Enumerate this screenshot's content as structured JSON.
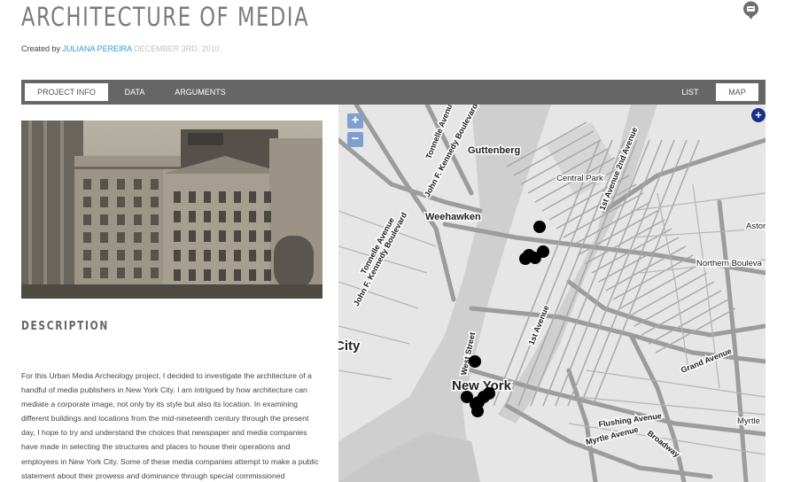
{
  "project": {
    "title": "ARCHITECTURE OF MEDIA",
    "created_by_label": "Created by",
    "author": "JULIANA PEREIRA",
    "date": "DECEMBER 3RD, 2010"
  },
  "nav": {
    "project_info": "PROJECT INFO",
    "data": "DATA",
    "arguments": "ARGUMENTS",
    "list": "LIST",
    "map": "MAP"
  },
  "description": {
    "heading": "DESCRIPTION",
    "body": "For this Urban Media Archeology project, I decided to investigate the architecture of a handful of media publishers in New York City. I am intrigued by how architecture can mediate a corporate image, not only by its style but also its location. In examining different buildings and locations from the mid-nineteenth century through the present day, I hope to try and understand the choices that newspaper and media companies have made in selecting the structures and places to house their operations and employees in New York City. Some of these media companies attempt to make a public statement about their prowess and dominance through special commissioned"
  },
  "map": {
    "zoom_in": "+",
    "zoom_out": "−",
    "layers": "+",
    "labels": {
      "tonnelle_avenue_top": "Tonnelle Avenue",
      "jfk_boulevard_top": "John F. Kennedy Boulevard",
      "guttenberg": "Guttenberg",
      "central_park": "Central Park",
      "first_second_avenue": "1st Avenue 2nd Avenue",
      "weehawken": "Weehawken",
      "tonnelle_avenue": "Tonnelle Avenue",
      "jfk_boulevard": "John F. Kennedy Boulevard",
      "astoria": "Astor",
      "northern_boulevard": "Northern Bouleva",
      "first_avenue": "1st Avenue",
      "city": "City",
      "west_street": "West Street",
      "grand_avenue": "Grand Avenue",
      "new_york": "New York",
      "flushing_avenue": "Flushing Avenue",
      "myrtle": "Myrtle",
      "myrtle_avenue": "Myrtle Avenue",
      "broadway": "Broadway"
    },
    "marker_color": "#000000"
  },
  "colors": {
    "accent": "#2f9bd6",
    "nav_bar": "#666666",
    "title": "#7b7b7b"
  }
}
